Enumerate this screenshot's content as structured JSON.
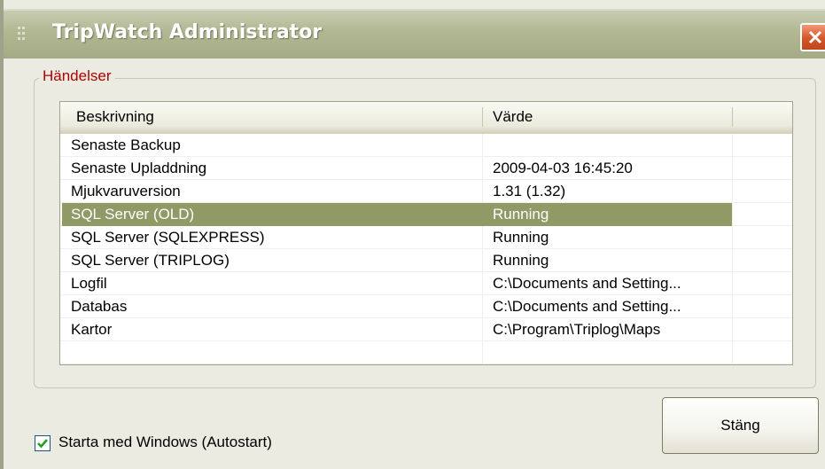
{
  "window": {
    "title": "TripWatch Administrator"
  },
  "groupbox": {
    "label": "Händelser"
  },
  "listview": {
    "columns": [
      "Beskrivning",
      "Värde"
    ],
    "rows": [
      {
        "desc": "Senaste Backup",
        "value": ""
      },
      {
        "desc": "Senaste Upladdning",
        "value": "2009-04-03 16:45:20"
      },
      {
        "desc": "Mjukvaruversion",
        "value": "1.31 (1.32)"
      },
      {
        "desc": "SQL Server (OLD)",
        "value": "Running",
        "selected": true
      },
      {
        "desc": "SQL Server (SQLEXPRESS)",
        "value": "Running"
      },
      {
        "desc": "SQL Server (TRIPLOG)",
        "value": "Running"
      },
      {
        "desc": "Logfil",
        "value": "C:\\Documents and Setting..."
      },
      {
        "desc": "Databas",
        "value": "C:\\Documents and Setting..."
      },
      {
        "desc": "Kartor",
        "value": "C:\\Program\\Triplog\\Maps"
      }
    ]
  },
  "autostart": {
    "label": "Starta med Windows (Autostart)",
    "checked": true
  },
  "buttons": {
    "close_label": "Stäng"
  },
  "colors": {
    "titlebar": "#b1b791",
    "selection": "#8f9a66",
    "group_label": "#b00000",
    "close_button": "#d45528"
  }
}
